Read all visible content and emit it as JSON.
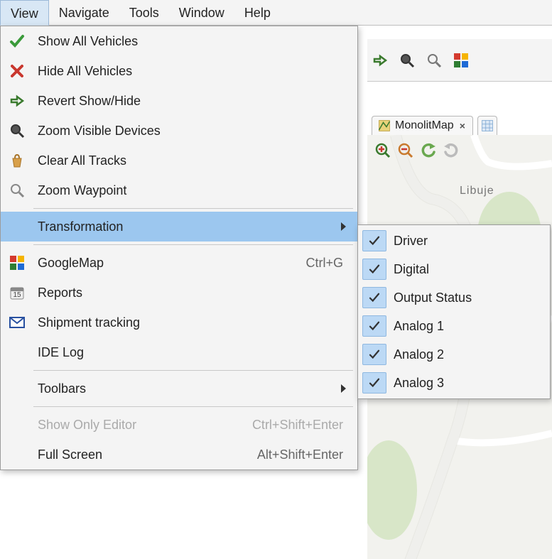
{
  "menubar": {
    "view": "View",
    "navigate": "Navigate",
    "tools": "Tools",
    "window": "Window",
    "help": "Help"
  },
  "viewMenu": {
    "showAll": "Show All Vehicles",
    "hideAll": "Hide All Vehicles",
    "revert": "Revert Show/Hide",
    "zoomVisible": "Zoom Visible Devices",
    "clearTracks": "Clear All Tracks",
    "zoomWaypoint": "Zoom Waypoint",
    "transformation": "Transformation",
    "googleMap": "GoogleMap",
    "googleMapShortcut": "Ctrl+G",
    "reports": "Reports",
    "shipment": "Shipment tracking",
    "ideLog": "IDE Log",
    "toolbars": "Toolbars",
    "showOnlyEditor": "Show Only Editor",
    "showOnlyEditorShortcut": "Ctrl+Shift+Enter",
    "fullScreen": "Full Screen",
    "fullScreenShortcut": "Alt+Shift+Enter"
  },
  "transformationSub": {
    "driver": "Driver",
    "digital": "Digital",
    "outputStatus": "Output Status",
    "analog1": "Analog 1",
    "analog2": "Analog 2",
    "analog3": "Analog 3"
  },
  "tab": {
    "label": "MonolitMap"
  },
  "map": {
    "placeLabel": "Libuje"
  }
}
